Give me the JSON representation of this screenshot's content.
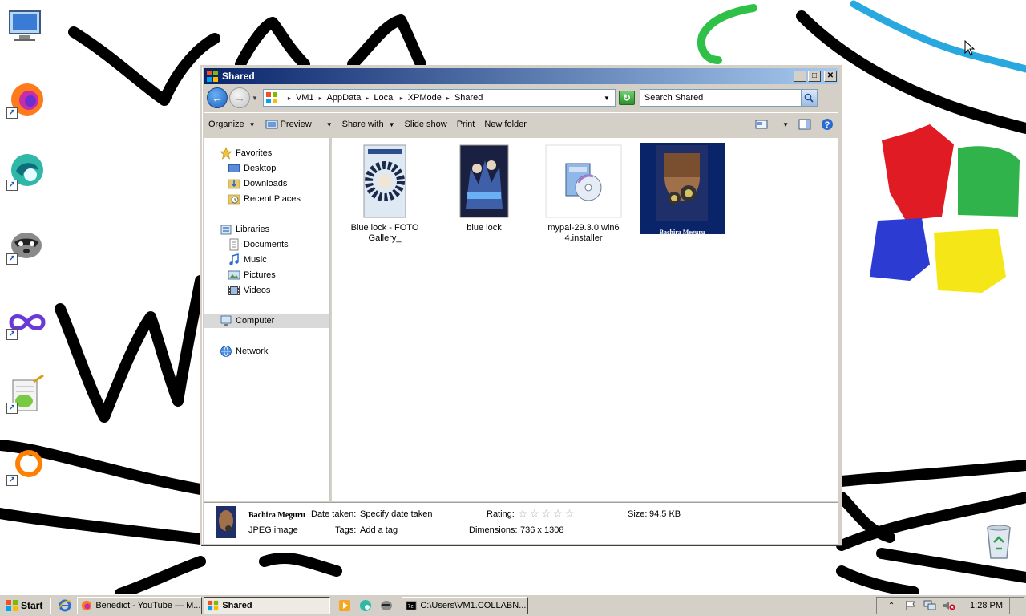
{
  "window": {
    "title": "Shared",
    "minimize_label": "_",
    "maximize_label": "□",
    "close_label": "✕"
  },
  "address": {
    "crumbs": [
      "VM1",
      "AppData",
      "Local",
      "XPMode",
      "Shared"
    ]
  },
  "search": {
    "placeholder": "Search Shared"
  },
  "toolbar": {
    "organize": "Organize",
    "preview": "Preview",
    "share_with": "Share with",
    "slide_show": "Slide show",
    "print": "Print",
    "new_folder": "New folder"
  },
  "navpane": {
    "favorites": "Favorites",
    "desktop": "Desktop",
    "downloads": "Downloads",
    "recent_places": "Recent Places",
    "libraries": "Libraries",
    "documents": "Documents",
    "music": "Music",
    "pictures": "Pictures",
    "videos": "Videos",
    "computer": "Computer",
    "network": "Network"
  },
  "files": [
    {
      "name_line1": "Blue lock - FOTO",
      "name_line2": "Gallery_"
    },
    {
      "name_line1": "blue lock",
      "name_line2": ""
    },
    {
      "name_line1": "mypal-29.3.0.win6",
      "name_line2": "4.installer"
    },
    {
      "name_line1": "",
      "name_line2": "",
      "thumb_caption": "Bachira Meguru"
    }
  ],
  "details": {
    "title": "Bachira Meguru",
    "type": "JPEG image",
    "date_taken_label": "Date taken:",
    "date_taken_value": "Specify date taken",
    "tags_label": "Tags:",
    "tags_value": "Add a tag",
    "rating_label": "Rating:",
    "rating_stars": "☆☆☆☆☆",
    "dimensions_label": "Dimensions:",
    "dimensions_value": "736 x 1308",
    "size_label": "Size:",
    "size_value": "94.5 KB"
  },
  "taskbar": {
    "start": "Start",
    "tasks": [
      "Benedict - YouTube — M...",
      "Shared",
      "C:\\Users\\VM1.COLLABN..."
    ],
    "clock": "1:28 PM"
  },
  "colors": {
    "titlebar_start": "#0a246a",
    "titlebar_end": "#a6caf0",
    "selection": "#0a246a"
  }
}
